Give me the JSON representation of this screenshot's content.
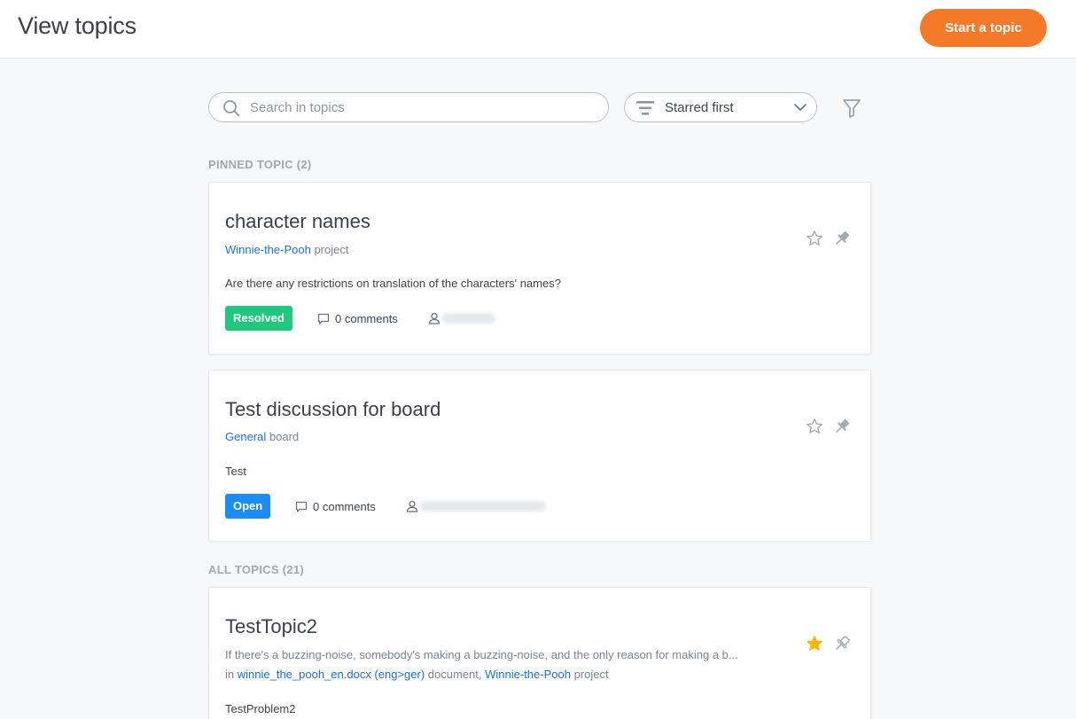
{
  "header": {
    "title": "View topics",
    "start_button": "Start a topic"
  },
  "toolbar": {
    "search_placeholder": "Search in topics",
    "search_value": "",
    "sort_selected": "Starred first"
  },
  "sections": {
    "pinned_label": "PINNED TOPIC (2)",
    "all_label": "ALL TOPICS (21)"
  },
  "pinned": [
    {
      "title": "character names",
      "source_link": "Winnie-the-Pooh",
      "source_type": "project",
      "body": "Are there any restrictions on translation of the characters' names?",
      "status": "Resolved",
      "comments": "0 comments",
      "starred": false
    },
    {
      "title": "Test discussion for board",
      "source_link": "General",
      "source_type": "board",
      "body": "Test",
      "status": "Open",
      "comments": "0 comments",
      "starred": false
    }
  ],
  "all": [
    {
      "title": "TestTopic2",
      "excerpt": "If there's a buzzing-noise, somebody's making a buzzing-noise, and the only reason for making a b...",
      "in_prefix": "in",
      "document_link": "winnie_the_pooh_en.docx (eng>ger)",
      "document_type": "document,",
      "project_link": "Winnie-the-Pooh",
      "project_type": "project",
      "body": "TestProblem2",
      "starred": true
    }
  ],
  "colors": {
    "accent": "#f47a2a",
    "resolved": "#20c77d",
    "open": "#1c8cf0",
    "link": "#1e6fd0",
    "star_active": "#f5b800"
  }
}
